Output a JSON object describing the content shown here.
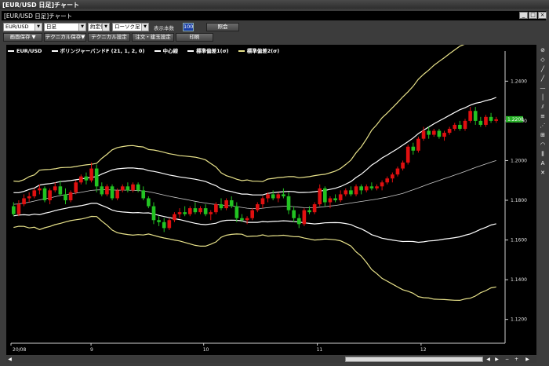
{
  "window": {
    "title": "[EUR/USD 日足]チャート",
    "inner_title": "[EUR/USD 日足]チャート"
  },
  "toolbar": {
    "pair": "EUR/USD",
    "period": "日足",
    "price_type": "約定値",
    "chart_type": "ローソク足",
    "display_count_label": "表示本数",
    "display_count_value": "100",
    "apply_label": "照会",
    "save_screen": "画面保存 ▼",
    "save_technical": "テクニカル保存▼",
    "technical_settings": "テクニカル設定",
    "order_settings": "注文・建玉設定",
    "print": "印刷"
  },
  "legend": {
    "instrument": "EUR/USD",
    "indicator": "ボリンジャーバンドF (21, 1, 2, 0)",
    "center": "中心線",
    "sigma1": "標準偏差1(σ)",
    "sigma2": "標準偏差2(σ)"
  },
  "colors": {
    "up": "#e01010",
    "down": "#22c322",
    "center": "#ffffff",
    "sigma1": "#ffffff",
    "sigma2": "#e8e28a",
    "sigma_thin": "#c8c8a0",
    "price_tag": "#25b025"
  },
  "current_price_label": "1.2208",
  "chart_data": {
    "type": "candlestick",
    "y_ticks": [
      "1.2400",
      "1.2200",
      "1.2000",
      "1.1800",
      "1.1600",
      "1.1400",
      "1.1200"
    ],
    "x_ticks": [
      "20/08",
      "9",
      "10",
      "11",
      "12"
    ],
    "ylim": [
      1.108,
      1.252
    ],
    "series": [
      {
        "name": "EUR/USD",
        "ohlc": [
          [
            1.177,
            1.179,
            1.172,
            1.173
          ],
          [
            1.173,
            1.18,
            1.172,
            1.178
          ],
          [
            1.178,
            1.183,
            1.177,
            1.181
          ],
          [
            1.181,
            1.184,
            1.179,
            1.182
          ],
          [
            1.182,
            1.186,
            1.181,
            1.185
          ],
          [
            1.185,
            1.188,
            1.183,
            1.186
          ],
          [
            1.186,
            1.187,
            1.179,
            1.18
          ],
          [
            1.18,
            1.186,
            1.178,
            1.185
          ],
          [
            1.185,
            1.189,
            1.184,
            1.187
          ],
          [
            1.187,
            1.19,
            1.182,
            1.183
          ],
          [
            1.183,
            1.186,
            1.178,
            1.18
          ],
          [
            1.18,
            1.185,
            1.179,
            1.184
          ],
          [
            1.184,
            1.19,
            1.183,
            1.189
          ],
          [
            1.189,
            1.193,
            1.188,
            1.192
          ],
          [
            1.192,
            1.194,
            1.188,
            1.19
          ],
          [
            1.19,
            1.199,
            1.189,
            1.196
          ],
          [
            1.196,
            1.198,
            1.184,
            1.187
          ],
          [
            1.187,
            1.189,
            1.182,
            1.183
          ],
          [
            1.183,
            1.188,
            1.182,
            1.187
          ],
          [
            1.187,
            1.188,
            1.18,
            1.181
          ],
          [
            1.181,
            1.186,
            1.18,
            1.185
          ],
          [
            1.185,
            1.188,
            1.184,
            1.187
          ],
          [
            1.187,
            1.189,
            1.184,
            1.185
          ],
          [
            1.185,
            1.189,
            1.184,
            1.188
          ],
          [
            1.188,
            1.189,
            1.184,
            1.185
          ],
          [
            1.185,
            1.187,
            1.18,
            1.181
          ],
          [
            1.181,
            1.182,
            1.176,
            1.177
          ],
          [
            1.177,
            1.179,
            1.168,
            1.17
          ],
          [
            1.17,
            1.172,
            1.167,
            1.169
          ],
          [
            1.169,
            1.171,
            1.164,
            1.166
          ],
          [
            1.166,
            1.171,
            1.165,
            1.17
          ],
          [
            1.17,
            1.174,
            1.169,
            1.173
          ],
          [
            1.173,
            1.176,
            1.171,
            1.174
          ],
          [
            1.174,
            1.177,
            1.172,
            1.173
          ],
          [
            1.173,
            1.177,
            1.172,
            1.176
          ],
          [
            1.176,
            1.179,
            1.173,
            1.174
          ],
          [
            1.174,
            1.177,
            1.173,
            1.176
          ],
          [
            1.176,
            1.178,
            1.172,
            1.173
          ],
          [
            1.173,
            1.175,
            1.17,
            1.174
          ],
          [
            1.174,
            1.179,
            1.173,
            1.178
          ],
          [
            1.178,
            1.181,
            1.175,
            1.176
          ],
          [
            1.176,
            1.181,
            1.175,
            1.18
          ],
          [
            1.18,
            1.182,
            1.176,
            1.177
          ],
          [
            1.177,
            1.179,
            1.169,
            1.171
          ],
          [
            1.171,
            1.173,
            1.169,
            1.17
          ],
          [
            1.17,
            1.172,
            1.168,
            1.171
          ],
          [
            1.171,
            1.176,
            1.17,
            1.175
          ],
          [
            1.175,
            1.179,
            1.174,
            1.178
          ],
          [
            1.178,
            1.182,
            1.176,
            1.181
          ],
          [
            1.181,
            1.184,
            1.179,
            1.183
          ],
          [
            1.183,
            1.185,
            1.18,
            1.181
          ],
          [
            1.181,
            1.184,
            1.179,
            1.183
          ],
          [
            1.183,
            1.186,
            1.181,
            1.182
          ],
          [
            1.182,
            1.184,
            1.173,
            1.175
          ],
          [
            1.175,
            1.177,
            1.169,
            1.171
          ],
          [
            1.171,
            1.173,
            1.166,
            1.168
          ],
          [
            1.168,
            1.176,
            1.167,
            1.175
          ],
          [
            1.175,
            1.177,
            1.173,
            1.174
          ],
          [
            1.174,
            1.179,
            1.173,
            1.178
          ],
          [
            1.178,
            1.188,
            1.177,
            1.186
          ],
          [
            1.186,
            1.187,
            1.177,
            1.179
          ],
          [
            1.179,
            1.182,
            1.176,
            1.181
          ],
          [
            1.181,
            1.183,
            1.179,
            1.18
          ],
          [
            1.18,
            1.185,
            1.179,
            1.183
          ],
          [
            1.183,
            1.186,
            1.182,
            1.185
          ],
          [
            1.185,
            1.187,
            1.182,
            1.183
          ],
          [
            1.183,
            1.188,
            1.182,
            1.187
          ],
          [
            1.187,
            1.188,
            1.183,
            1.185
          ],
          [
            1.185,
            1.188,
            1.184,
            1.187
          ],
          [
            1.187,
            1.189,
            1.185,
            1.186
          ],
          [
            1.186,
            1.188,
            1.185,
            1.187
          ],
          [
            1.187,
            1.19,
            1.185,
            1.189
          ],
          [
            1.189,
            1.192,
            1.188,
            1.191
          ],
          [
            1.191,
            1.194,
            1.189,
            1.193
          ],
          [
            1.193,
            1.197,
            1.192,
            1.196
          ],
          [
            1.196,
            1.2,
            1.195,
            1.199
          ],
          [
            1.199,
            1.208,
            1.198,
            1.207
          ],
          [
            1.207,
            1.209,
            1.203,
            1.205
          ],
          [
            1.205,
            1.212,
            1.204,
            1.211
          ],
          [
            1.211,
            1.217,
            1.21,
            1.215
          ],
          [
            1.215,
            1.217,
            1.211,
            1.213
          ],
          [
            1.213,
            1.216,
            1.212,
            1.215
          ],
          [
            1.215,
            1.216,
            1.211,
            1.212
          ],
          [
            1.212,
            1.215,
            1.21,
            1.214
          ],
          [
            1.214,
            1.217,
            1.213,
            1.216
          ],
          [
            1.216,
            1.219,
            1.215,
            1.218
          ],
          [
            1.218,
            1.22,
            1.215,
            1.216
          ],
          [
            1.216,
            1.221,
            1.215,
            1.22
          ],
          [
            1.22,
            1.227,
            1.219,
            1.225
          ],
          [
            1.225,
            1.227,
            1.218,
            1.22
          ],
          [
            1.22,
            1.222,
            1.217,
            1.218
          ],
          [
            1.218,
            1.223,
            1.217,
            1.222
          ],
          [
            1.222,
            1.224,
            1.219,
            1.22
          ],
          [
            1.22,
            1.222,
            1.219,
            1.2208
          ]
        ]
      },
      {
        "name": "中心線",
        "values": [
          1.178,
          1.1782,
          1.1786,
          1.179,
          1.1796,
          1.1802,
          1.1808,
          1.1812,
          1.1818,
          1.1824,
          1.1828,
          1.1832,
          1.1836,
          1.184,
          1.1845,
          1.185,
          1.1852,
          1.1853,
          1.1853,
          1.1852,
          1.1851,
          1.1851,
          1.1851,
          1.185,
          1.1849,
          1.1847,
          1.1843,
          1.1838,
          1.1832,
          1.1826,
          1.182,
          1.1815,
          1.181,
          1.1805,
          1.18,
          1.1795,
          1.179,
          1.1786,
          1.1782,
          1.1779,
          1.1776,
          1.1774,
          1.1772,
          1.1768,
          1.1764,
          1.176,
          1.1758,
          1.1758,
          1.176,
          1.1763,
          1.1766,
          1.1768,
          1.177,
          1.177,
          1.1768,
          1.1765,
          1.1763,
          1.1762,
          1.1762,
          1.1765,
          1.1768,
          1.1771,
          1.1774,
          1.1778,
          1.1782,
          1.1786,
          1.179,
          1.1794,
          1.1798,
          1.1802,
          1.1806,
          1.1811,
          1.1816,
          1.1822,
          1.1828,
          1.1835,
          1.1844,
          1.1853,
          1.1862,
          1.1872,
          1.1882,
          1.1891,
          1.19,
          1.1909,
          1.1918,
          1.1927,
          1.1936,
          1.1945,
          1.1955,
          1.1965,
          1.1974,
          1.1983,
          1.1992,
          1.2
        ]
      }
    ]
  }
}
